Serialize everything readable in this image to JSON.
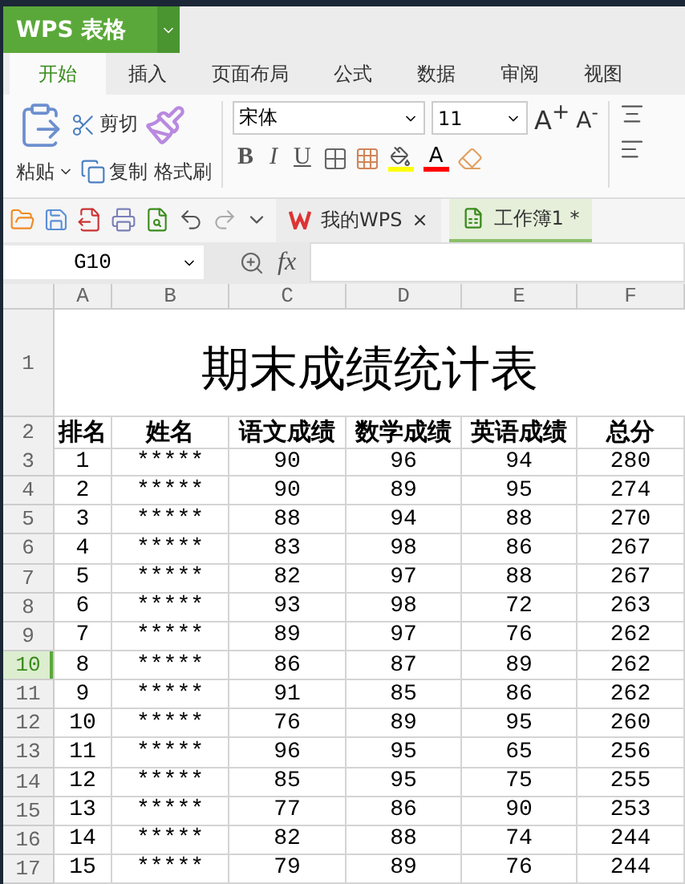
{
  "app": {
    "title": "WPS 表格"
  },
  "ribbon_tabs": [
    {
      "label": "开始",
      "selected": true
    },
    {
      "label": "插入",
      "selected": false
    },
    {
      "label": "页面布局",
      "selected": false
    },
    {
      "label": "公式",
      "selected": false
    },
    {
      "label": "数据",
      "selected": false
    },
    {
      "label": "审阅",
      "selected": false
    },
    {
      "label": "视图",
      "selected": false
    }
  ],
  "clipboard": {
    "paste": "粘贴",
    "cut": "剪切",
    "copy": "复制",
    "format_painter": "格式刷"
  },
  "font": {
    "name": "宋体",
    "size": "11",
    "grow": "A$^{+}$",
    "shrink": "A$^{-}$",
    "bold": "B",
    "italic": "I",
    "underline": "U",
    "font_color_label": "A"
  },
  "doc_tabs": [
    {
      "label": "我的WPS",
      "selected": false,
      "close": "×"
    },
    {
      "label": "工作簿1 *",
      "selected": true
    }
  ],
  "formula_bar": {
    "cell": "G10",
    "fx": "fx"
  },
  "sheet": {
    "columns": [
      "A",
      "B",
      "C",
      "D",
      "E",
      "F"
    ],
    "title_row": {
      "number": "1",
      "text": "期末成绩统计表"
    },
    "header_row": {
      "number": "2",
      "cells": [
        "排名",
        "姓名",
        "语文成绩",
        "数学成绩",
        "英语成绩",
        "总分"
      ]
    },
    "rows": [
      {
        "number": "3",
        "selected": false,
        "cells": [
          "1",
          "*****",
          "90",
          "96",
          "94",
          "280"
        ]
      },
      {
        "number": "4",
        "selected": false,
        "cells": [
          "2",
          "*****",
          "90",
          "89",
          "95",
          "274"
        ]
      },
      {
        "number": "5",
        "selected": false,
        "cells": [
          "3",
          "*****",
          "88",
          "94",
          "88",
          "270"
        ]
      },
      {
        "number": "6",
        "selected": false,
        "cells": [
          "4",
          "*****",
          "83",
          "98",
          "86",
          "267"
        ]
      },
      {
        "number": "7",
        "selected": false,
        "cells": [
          "5",
          "*****",
          "82",
          "97",
          "88",
          "267"
        ]
      },
      {
        "number": "8",
        "selected": false,
        "cells": [
          "6",
          "*****",
          "93",
          "98",
          "72",
          "263"
        ]
      },
      {
        "number": "9",
        "selected": false,
        "cells": [
          "7",
          "*****",
          "89",
          "97",
          "76",
          "262"
        ]
      },
      {
        "number": "10",
        "selected": true,
        "cells": [
          "8",
          "*****",
          "86",
          "87",
          "89",
          "262"
        ]
      },
      {
        "number": "11",
        "selected": false,
        "cells": [
          "9",
          "*****",
          "91",
          "85",
          "86",
          "262"
        ]
      },
      {
        "number": "12",
        "selected": false,
        "cells": [
          "10",
          "*****",
          "76",
          "89",
          "95",
          "260"
        ]
      },
      {
        "number": "13",
        "selected": false,
        "cells": [
          "11",
          "*****",
          "96",
          "95",
          "65",
          "256"
        ]
      },
      {
        "number": "14",
        "selected": false,
        "cells": [
          "12",
          "*****",
          "85",
          "95",
          "75",
          "255"
        ]
      },
      {
        "number": "15",
        "selected": false,
        "cells": [
          "13",
          "*****",
          "77",
          "86",
          "90",
          "253"
        ]
      },
      {
        "number": "16",
        "selected": false,
        "cells": [
          "14",
          "*****",
          "82",
          "88",
          "74",
          "244"
        ]
      },
      {
        "number": "17",
        "selected": false,
        "cells": [
          "15",
          "*****",
          "79",
          "89",
          "76",
          "244"
        ]
      }
    ]
  }
}
